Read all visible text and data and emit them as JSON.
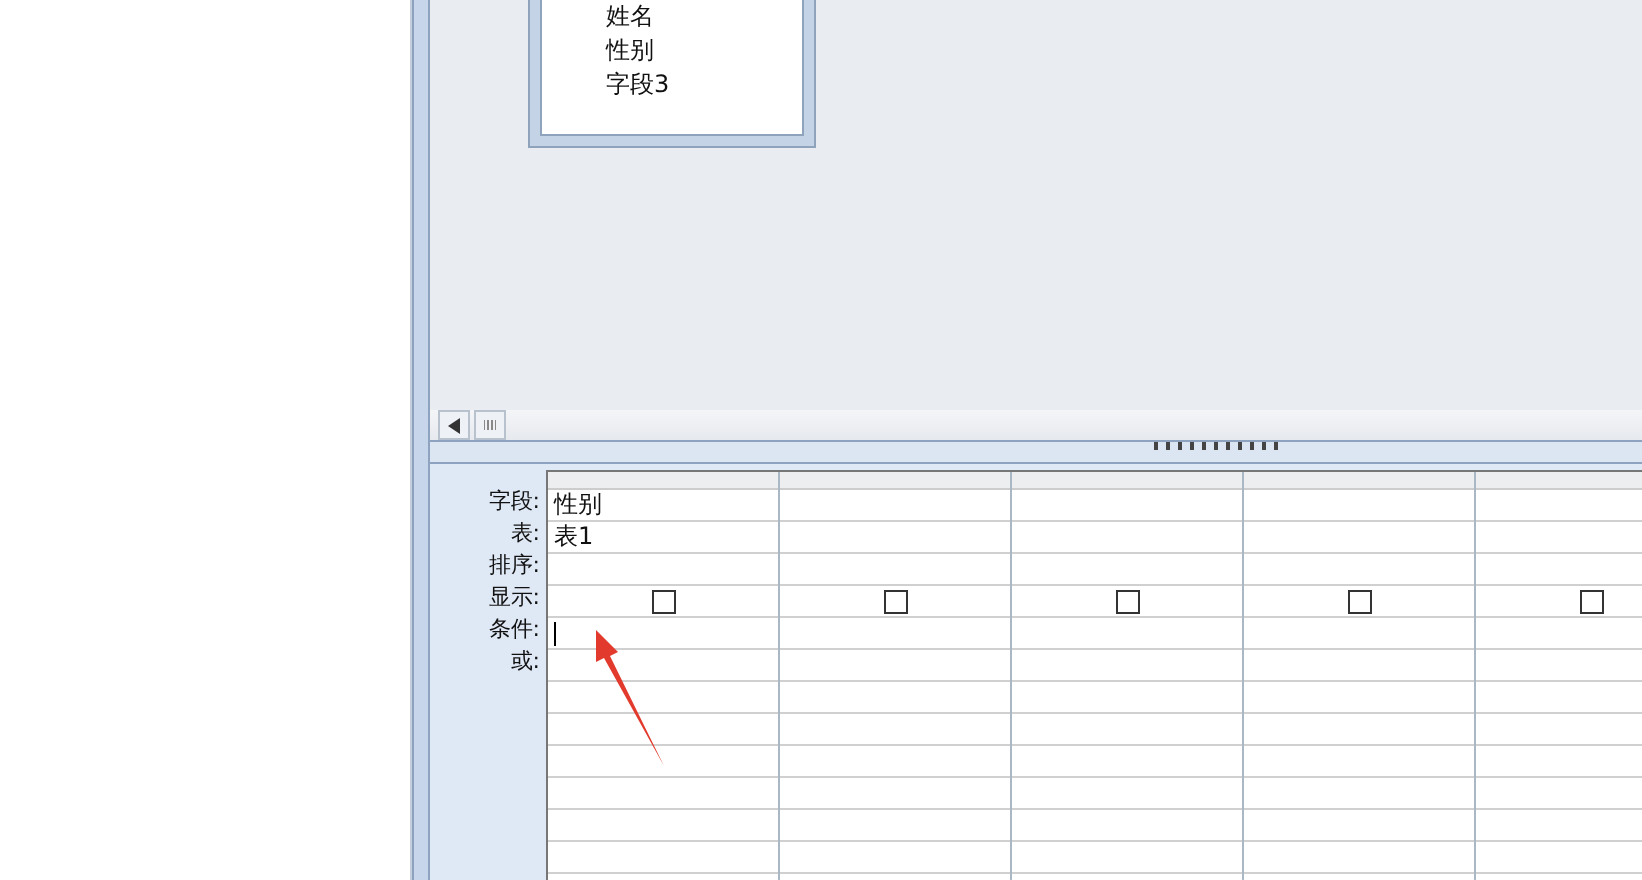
{
  "table_box": {
    "fields": [
      "姓名",
      "性别",
      "字段3"
    ]
  },
  "grid": {
    "row_labels": [
      "字段:",
      "表:",
      "排序:",
      "显示:",
      "条件:",
      "或:"
    ],
    "columns": [
      {
        "field": "性别",
        "table": "表1",
        "show": false
      },
      {
        "show": false
      },
      {
        "show": false
      },
      {
        "show": false
      },
      {
        "show": false
      }
    ]
  }
}
